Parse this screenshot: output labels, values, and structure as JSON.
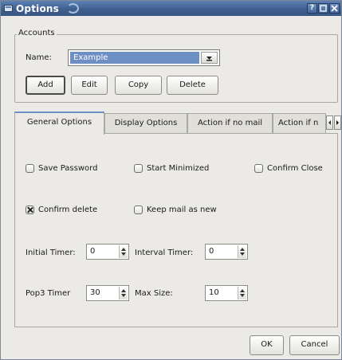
{
  "window": {
    "title": "Options",
    "title_buttons": [
      "?",
      "□",
      "×"
    ]
  },
  "accounts": {
    "group_label": "Accounts",
    "name_label": "Name:",
    "name_value": "Example",
    "buttons": {
      "add": "Add",
      "edit": "Edit",
      "copy": "Copy",
      "delete": "Delete"
    }
  },
  "tabs": [
    {
      "label": "General Options",
      "active": true
    },
    {
      "label": "Display Options",
      "active": false
    },
    {
      "label": "Action if no mail",
      "active": false
    },
    {
      "label": "Action if n",
      "active": false
    }
  ],
  "general": {
    "checkboxes": [
      {
        "label": "Save Password",
        "checked": false
      },
      {
        "label": "Start Minimized",
        "checked": false
      },
      {
        "label": "Confirm Close",
        "checked": false
      },
      {
        "label": "Confirm delete",
        "checked": true
      },
      {
        "label": "Keep mail as new",
        "checked": false
      }
    ],
    "initial_timer": {
      "label": "Initial Timer:",
      "value": "0"
    },
    "interval_timer": {
      "label": "Interval Timer:",
      "value": "0"
    },
    "pop3_timer": {
      "label": "Pop3 Timer",
      "value": "30"
    },
    "max_size": {
      "label": "Max Size:",
      "value": "10"
    }
  },
  "footer": {
    "ok": "OK",
    "cancel": "Cancel"
  },
  "colors": {
    "titlebar": "#3f5f8f",
    "selection": "#6e8fc4",
    "window_bg": "#ebeae6"
  }
}
